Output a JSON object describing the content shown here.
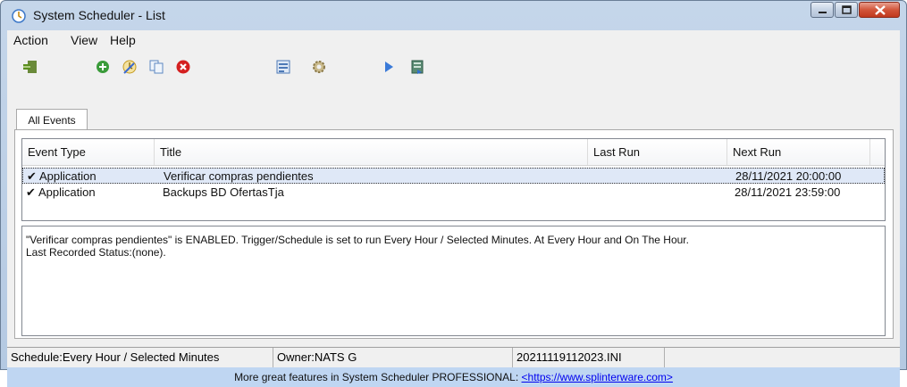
{
  "window": {
    "title": "System Scheduler - List"
  },
  "menu": [
    "Action",
    "View",
    "Help"
  ],
  "toolbar": {
    "icons": [
      "exit-icon",
      "add-icon",
      "edit-icon",
      "copy-icon",
      "delete-icon",
      "log-icon",
      "settings-icon",
      "run-icon",
      "scheduler-icon"
    ]
  },
  "tabs": [
    "All Events"
  ],
  "list": {
    "columns": [
      "Event Type",
      "Title",
      "Last Run",
      "Next Run"
    ],
    "rows": [
      {
        "type": "Application",
        "title": "Verificar compras pendientes",
        "last_run": "",
        "next_run": "28/11/2021 20:00:00",
        "selected": true
      },
      {
        "type": "Application",
        "title": "Backups BD OfertasTja",
        "last_run": "",
        "next_run": "28/11/2021 23:59:00",
        "selected": false
      }
    ]
  },
  "description": {
    "line1": "\"Verificar compras pendientes\" is ENABLED. Trigger/Schedule is set to run Every Hour / Selected Minutes. At Every Hour and On The Hour.",
    "line2": "Last Recorded Status:(none)."
  },
  "status": {
    "schedule": "Schedule:Every Hour / Selected Minutes",
    "owner": "Owner:NATS G",
    "file": "20211119112023.INI"
  },
  "promo": {
    "text": "More great features in System Scheduler PROFESSIONAL: ",
    "link": "<https://www.splinterware.com>"
  },
  "colors": {
    "promo_bg": "#bfd6f2",
    "selection": "#dfe8f7",
    "delete_red": "#d42020",
    "add_green": "#3a9b3a"
  }
}
